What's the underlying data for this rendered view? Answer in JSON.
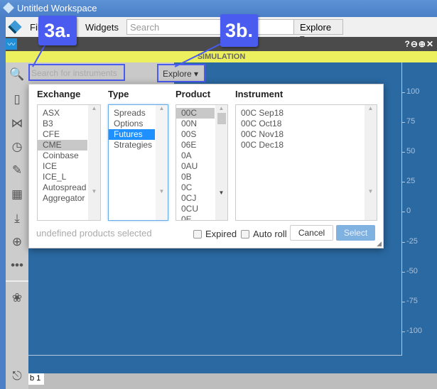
{
  "window": {
    "title": "Untitled Workspace"
  },
  "menu": {
    "file": "File",
    "widgets": "Widgets",
    "search_placeholder": "Search",
    "explore": "Explore ▾"
  },
  "widget": {
    "controls": "?⊖⊕✕",
    "mode_banner": "SIMULATION",
    "search_placeholder": "Search for instruments",
    "explore": "Explore ▾",
    "tab": "b 1"
  },
  "sidebar": {
    "icons": [
      "search-icon",
      "candlestick-icon",
      "compass-icon",
      "clock-icon",
      "pencil-icon",
      "grid-icon",
      "download-icon",
      "crosshair-icon",
      "more-icon",
      "settings-icon",
      "pin-icon"
    ]
  },
  "axis": {
    "ticks": [
      "100",
      "75",
      "50",
      "25",
      "0",
      "-25",
      "-50",
      "-75",
      "-100"
    ]
  },
  "dialog": {
    "headers": {
      "exchange": "Exchange",
      "type": "Type",
      "product": "Product",
      "instrument": "Instrument"
    },
    "exchanges": [
      "ASX",
      "B3",
      "CFE",
      "CME",
      "Coinbase",
      "ICE",
      "ICE_L",
      "Autospread",
      "Aggregator"
    ],
    "selected_exchange": "CME",
    "types": [
      "Spreads",
      "Options",
      "Futures",
      "Strategies"
    ],
    "selected_type": "Futures",
    "products": [
      "00C",
      "00N",
      "00S",
      "06E",
      "0A",
      "0AU",
      "0B",
      "0C",
      "0CJ",
      "0CU",
      "0E"
    ],
    "selected_product": "00C",
    "instruments": [
      "00C Sep18",
      "00C Oct18",
      "00C Nov18",
      "00C Dec18"
    ],
    "status": "undefined products selected",
    "expired_label": "Expired",
    "expired_checked": false,
    "autoroll_label": "Auto roll",
    "autoroll_checked": false,
    "cancel": "Cancel",
    "select": "Select"
  },
  "annotations": {
    "a": "3a.",
    "b": "3b."
  },
  "colors": {
    "accent": "#4a5cf0",
    "chart_bg": "#2a69a2",
    "banner": "#ecef5e",
    "selection": "#1e90ff"
  }
}
